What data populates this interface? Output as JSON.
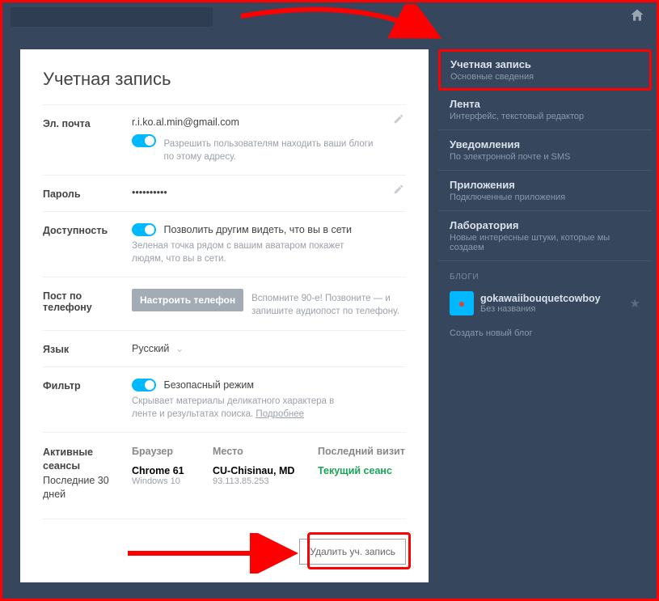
{
  "header": {
    "title": "Учетная запись"
  },
  "fields": {
    "email": {
      "label": "Эл. почта",
      "value": "r.i.ko.al.min@gmail.com",
      "toggle_text": "Разрешить пользователям находить ваши блоги по этому адресу."
    },
    "password": {
      "label": "Пароль",
      "value": "••••••••••"
    },
    "availability": {
      "label": "Доступность",
      "toggle_text": "Позволить другим видеть, что вы в сети",
      "hint": "Зеленая точка рядом с вашим аватаром покажет людям, что вы в сети."
    },
    "phone_post": {
      "label": "Пост по телефону",
      "button": "Настроить телефон",
      "hint": "Вспомните 90-е! Позвоните — и запишите аудиопост по телефону."
    },
    "language": {
      "label": "Язык",
      "value": "Русский"
    },
    "filter": {
      "label": "Фильтр",
      "toggle_text": "Безопасный режим",
      "hint": "Скрывает материалы деликатного характера в ленте и результатах поиска.",
      "more": "Подробнее"
    }
  },
  "sessions": {
    "label": "Активные сеансы",
    "sublabel": "Последние 30 дней",
    "columns": {
      "browser": "Браузер",
      "location": "Место",
      "last": "Последний визит"
    },
    "row": {
      "browser": "Chrome 61",
      "os": "Windows 10",
      "location": "CU-Chisinau, MD",
      "ip": "93.113.85.253",
      "last": "Текущий сеанс"
    }
  },
  "delete_btn": "Удалить уч. запись",
  "sidebar": {
    "items": [
      {
        "title": "Учетная запись",
        "sub": "Основные сведения"
      },
      {
        "title": "Лента",
        "sub": "Интерфейс, текстовый редактор"
      },
      {
        "title": "Уведомления",
        "sub": "По электронной почте и SMS"
      },
      {
        "title": "Приложения",
        "sub": "Подключенные приложения"
      },
      {
        "title": "Лаборатория",
        "sub": "Новые интересные штуки, которые мы создаем"
      }
    ],
    "section": "БЛОГИ",
    "blog": {
      "name": "gokawaiibouquetcowboy",
      "sub": "Без названия"
    },
    "create": "Создать новый блог"
  }
}
